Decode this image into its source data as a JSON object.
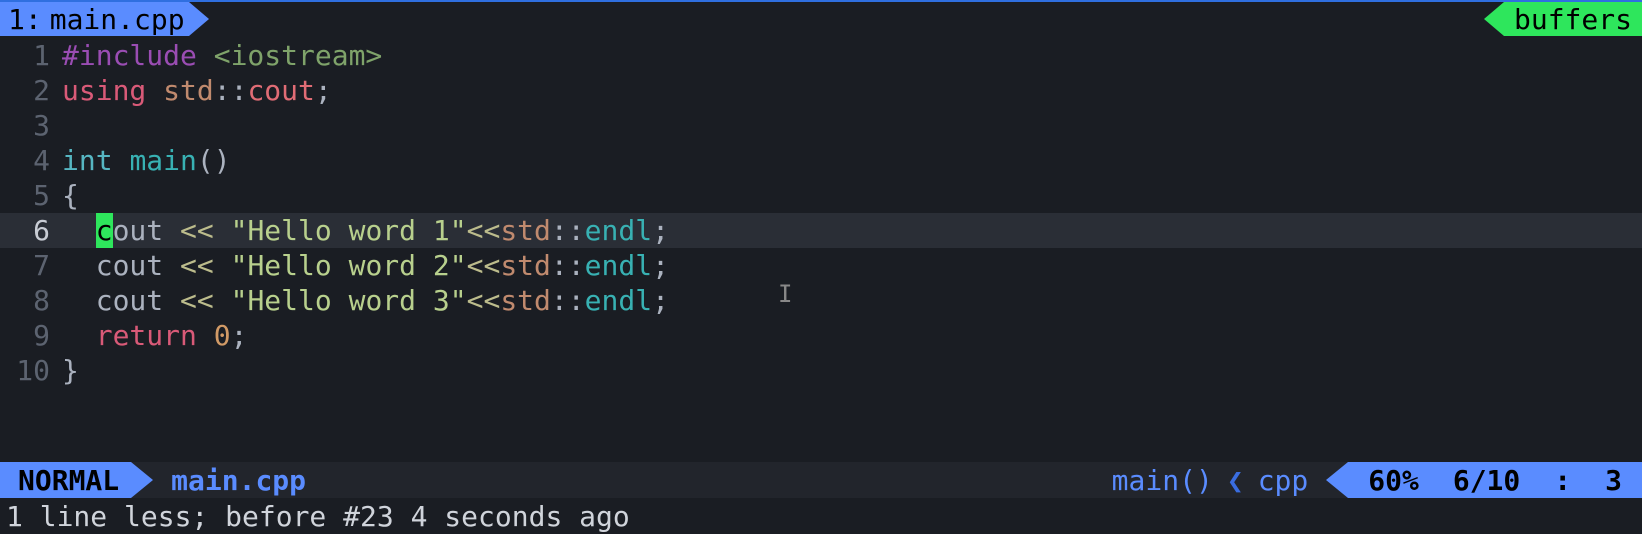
{
  "topbar": {
    "tab_index": "1:",
    "tab_name": "main.cpp",
    "right_label": "buffers"
  },
  "code": {
    "cursor_line": 6,
    "lines": [
      {
        "n": "1",
        "tokens": [
          [
            "pp",
            "#include "
          ],
          [
            "hdr",
            "<iostream>"
          ]
        ]
      },
      {
        "n": "2",
        "tokens": [
          [
            "kw",
            "using"
          ],
          [
            "punc",
            " "
          ],
          [
            "ns",
            "std"
          ],
          [
            "punc",
            "::"
          ],
          [
            "ident",
            "cout"
          ],
          [
            "punc",
            ";"
          ]
        ]
      },
      {
        "n": "3",
        "tokens": []
      },
      {
        "n": "4",
        "tokens": [
          [
            "typ",
            "int"
          ],
          [
            "punc",
            " "
          ],
          [
            "fn",
            "main"
          ],
          [
            "punc",
            "()"
          ]
        ]
      },
      {
        "n": "5",
        "tokens": [
          [
            "punc",
            "{"
          ]
        ]
      },
      {
        "n": "6",
        "tokens": [
          [
            "punc",
            "  "
          ],
          [
            "cursor",
            "c"
          ],
          [
            "id",
            "out"
          ],
          [
            "punc",
            " "
          ],
          [
            "op",
            "<<"
          ],
          [
            "punc",
            " "
          ],
          [
            "str",
            "\"Hello word 1\""
          ],
          [
            "op",
            "<<"
          ],
          [
            "ns",
            "std"
          ],
          [
            "punc",
            "::"
          ],
          [
            "fn",
            "endl"
          ],
          [
            "punc",
            ";"
          ]
        ]
      },
      {
        "n": "7",
        "tokens": [
          [
            "punc",
            "  "
          ],
          [
            "id",
            "cout"
          ],
          [
            "punc",
            " "
          ],
          [
            "op",
            "<<"
          ],
          [
            "punc",
            " "
          ],
          [
            "str",
            "\"Hello word 2\""
          ],
          [
            "op",
            "<<"
          ],
          [
            "ns",
            "std"
          ],
          [
            "punc",
            "::"
          ],
          [
            "fn",
            "endl"
          ],
          [
            "punc",
            ";"
          ]
        ]
      },
      {
        "n": "8",
        "tokens": [
          [
            "punc",
            "  "
          ],
          [
            "id",
            "cout"
          ],
          [
            "punc",
            " "
          ],
          [
            "op",
            "<<"
          ],
          [
            "punc",
            " "
          ],
          [
            "str",
            "\"Hello word 3\""
          ],
          [
            "op",
            "<<"
          ],
          [
            "ns",
            "std"
          ],
          [
            "punc",
            "::"
          ],
          [
            "fn",
            "endl"
          ],
          [
            "punc",
            ";"
          ]
        ]
      },
      {
        "n": "9",
        "tokens": [
          [
            "punc",
            "  "
          ],
          [
            "kw",
            "return"
          ],
          [
            "punc",
            " "
          ],
          [
            "num",
            "0"
          ],
          [
            "punc",
            ";"
          ]
        ]
      },
      {
        "n": "10",
        "tokens": [
          [
            "punc",
            "}"
          ]
        ]
      }
    ]
  },
  "status": {
    "mode": "NORMAL",
    "file": "main.cpp",
    "context_func": "main()",
    "context_type": "cpp",
    "percent": "60%",
    "line_total": "6/10",
    "col_sep": ":",
    "col": "3"
  },
  "message": "1 line less; before #23  4 seconds ago"
}
